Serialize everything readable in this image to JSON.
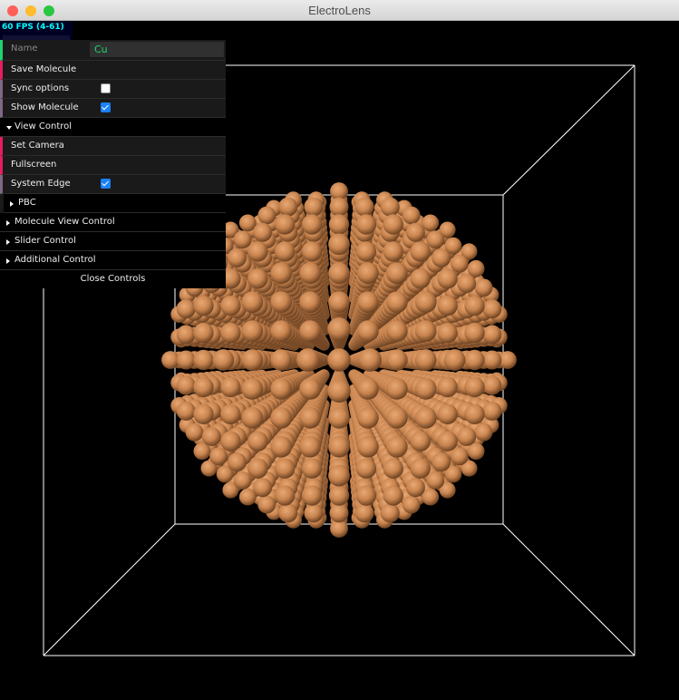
{
  "window": {
    "title": "ElectroLens",
    "colors": {
      "close": "#ff5f57",
      "minimize": "#febc2e",
      "maximize": "#28c840"
    }
  },
  "stats": {
    "fps_text": "60 FPS (4-61)",
    "fps": 60,
    "min": 4,
    "max": 61
  },
  "gui": {
    "name_label": "Name",
    "name_value": "Cu",
    "save_molecule": "Save Molecule",
    "sync_options": {
      "label": "Sync options",
      "checked": false
    },
    "show_molecule": {
      "label": "Show Molecule",
      "checked": true
    },
    "view_control": {
      "label": "View Control",
      "set_camera": "Set Camera",
      "fullscreen": "Fullscreen",
      "system_edge": {
        "label": "System Edge",
        "checked": true
      },
      "pbc": "PBC"
    },
    "molecule_view_control": "Molecule View Control",
    "slider_control": "Slider Control",
    "additional_control": "Additional Control",
    "close_controls": "Close Controls"
  },
  "scene": {
    "atom_color": "#c98550",
    "box_edge_color": "#ffffff",
    "background": "#000000"
  }
}
